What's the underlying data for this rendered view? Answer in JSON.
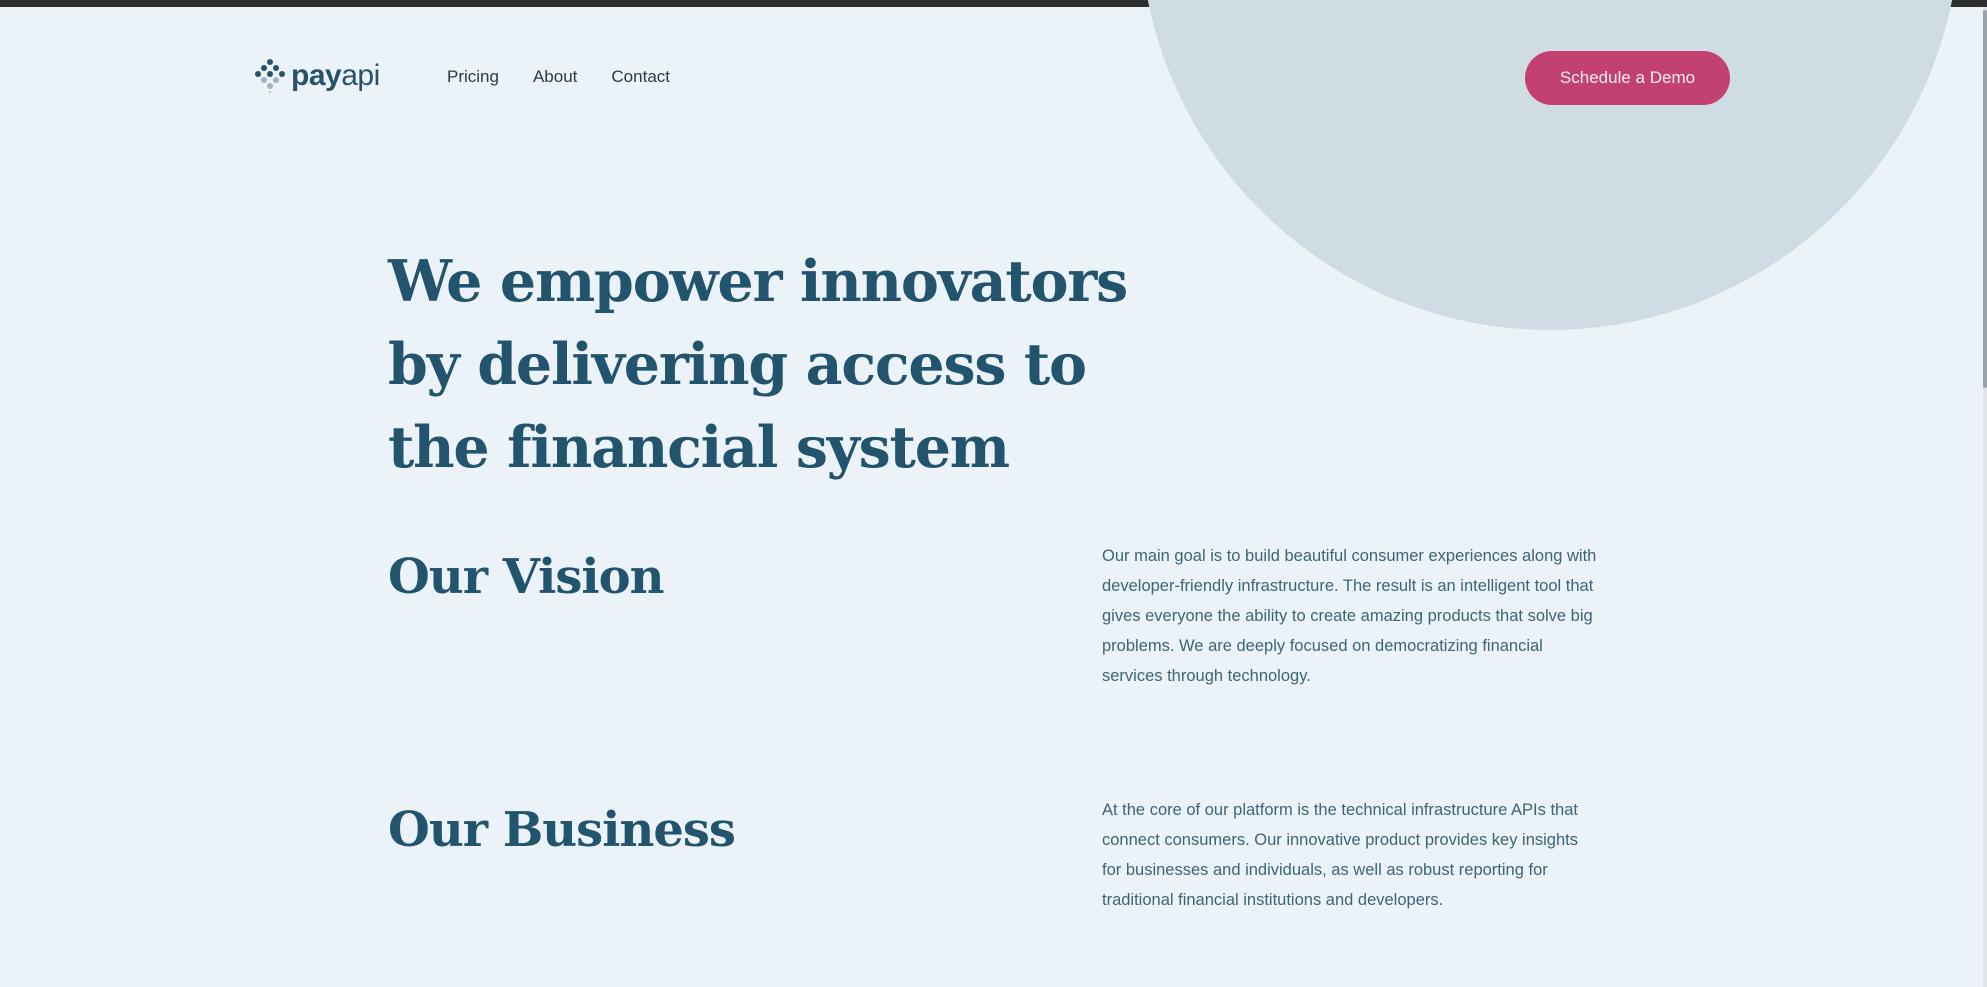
{
  "brand": {
    "logo_bold": "pay",
    "logo_light": "api"
  },
  "nav": {
    "items": [
      "Pricing",
      "About",
      "Contact"
    ]
  },
  "cta": {
    "label": "Schedule a Demo"
  },
  "hero": {
    "headline": "We empower innovators by delivering access to the financial system"
  },
  "vision": {
    "title": "Our Vision",
    "text": "Our main goal is to build beautiful consumer experiences along with developer-friendly infrastructure. The result is an intelligent tool that gives everyone the ability to create amazing products that solve big problems. We are deeply focused on democratizing financial services through technology."
  },
  "business": {
    "title": "Our Business",
    "text": "At the core of our platform is the technical infrastructure APIs that connect consumers. Our innovative product provides key insights for businesses and individuals, as well as robust reporting for traditional financial institutions and developers."
  },
  "colors": {
    "background": "#ebf2f8",
    "primary_text": "#22546e",
    "accent": "#c24171",
    "circle": "#cfdce4"
  }
}
